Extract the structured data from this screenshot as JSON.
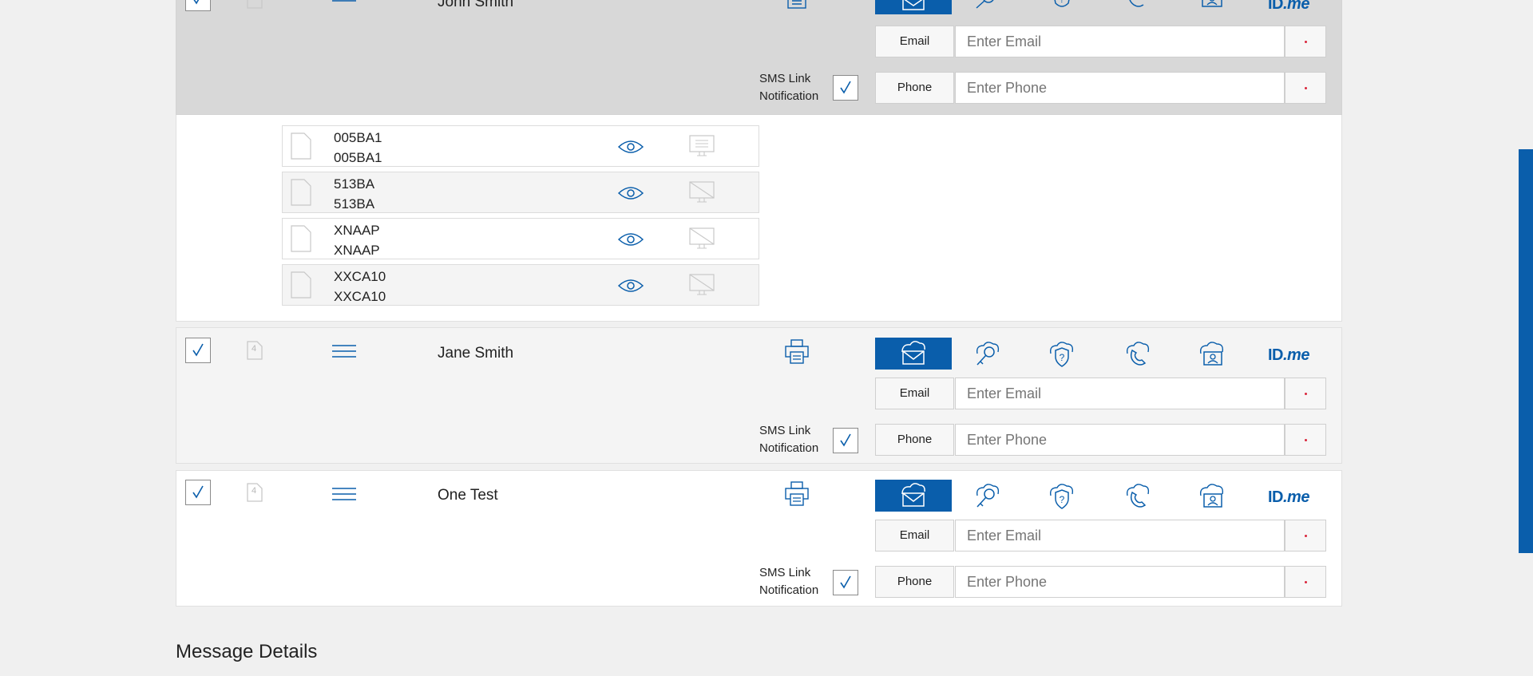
{
  "signers": [
    {
      "name": "John Smith",
      "email_label": "Email",
      "email_placeholder": "Enter Email",
      "phone_label": "Phone",
      "phone_placeholder": "Enter Phone",
      "sms_line1": "SMS Link",
      "sms_line2": "Notification",
      "idme_text": "ID",
      "idme_suffix": ".me"
    },
    {
      "name": "Jane Smith",
      "doc_count": "4",
      "email_label": "Email",
      "email_placeholder": "Enter Email",
      "phone_label": "Phone",
      "phone_placeholder": "Enter Phone",
      "sms_line1": "SMS Link",
      "sms_line2": "Notification",
      "idme_text": "ID",
      "idme_suffix": ".me"
    },
    {
      "name": "One Test",
      "doc_count": "4",
      "email_label": "Email",
      "email_placeholder": "Enter Email",
      "phone_label": "Phone",
      "phone_placeholder": "Enter Phone",
      "sms_line1": "SMS Link",
      "sms_line2": "Notification",
      "idme_text": "ID",
      "idme_suffix": ".me"
    }
  ],
  "documents": [
    {
      "code": "005BA1",
      "name": "005BA1"
    },
    {
      "code": "513BA",
      "name": "513BA"
    },
    {
      "code": "XNAAP",
      "name": "XNAAP"
    },
    {
      "code": "XXCA10",
      "name": "XXCA10"
    }
  ],
  "message_details_title": "Message Details",
  "colors": {
    "accent": "#0a5eab",
    "required": "#d9263c"
  }
}
